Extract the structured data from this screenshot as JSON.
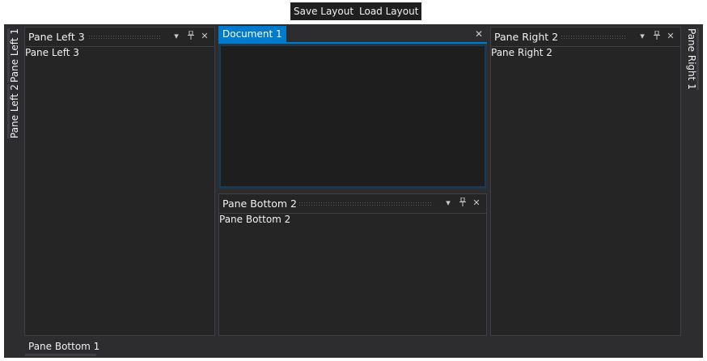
{
  "toolbar": {
    "save_label": "Save Layout",
    "load_label": "Load Layout"
  },
  "left_tabs": [
    "Pane Left 1",
    "Pane Left 2"
  ],
  "right_tabs": [
    "Pane Right 1"
  ],
  "bottom_tabs": [
    "Pane Bottom 1"
  ],
  "panes": {
    "left3": {
      "title": "Pane Left 3",
      "content": "Pane Left 3"
    },
    "right2": {
      "title": "Pane Right 2",
      "content": "Pane Right 2"
    },
    "bottom2": {
      "title": "Pane Bottom 2",
      "content": "Pane Bottom 2"
    }
  },
  "document": {
    "tab_label": "Document 1"
  },
  "icons": {
    "menu": "chevron-down-icon",
    "pin": "pin-icon",
    "close": "close-icon"
  },
  "colors": {
    "dock_bg": "#2d2d30",
    "pane_bg": "#252526",
    "accent": "#007acc",
    "document_bg": "#1e1e1e"
  }
}
